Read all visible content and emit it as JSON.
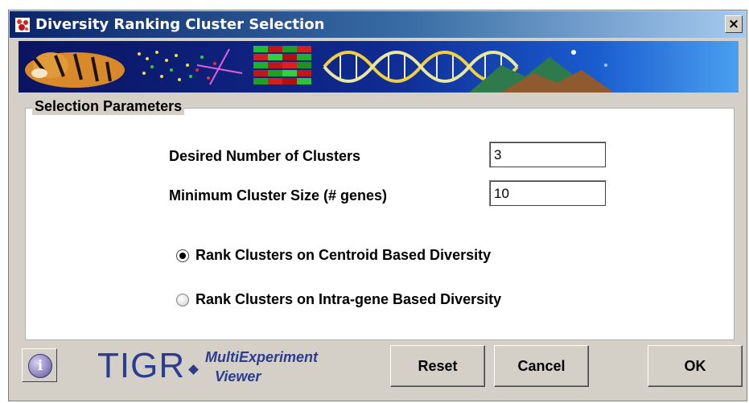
{
  "window": {
    "title": "Diversity Ranking Cluster Selection",
    "close_glyph": "×"
  },
  "params": {
    "legend": "Selection Parameters",
    "clusters_label": "Desired Number of Clusters",
    "clusters_value": "3",
    "min_size_label": "Minimum Cluster Size (# genes)",
    "min_size_value": "10",
    "radios": [
      {
        "label": "Rank Clusters on Centroid Based Diversity",
        "checked": true
      },
      {
        "label": "Rank Clusters on Intra-gene Based Diversity",
        "checked": false
      }
    ]
  },
  "footer": {
    "info_glyph": "i",
    "logo_tigr": "TIGR",
    "logo_line1": "MultiExperiment",
    "logo_line2": "Viewer",
    "reset_label": "Reset",
    "cancel_label": "Cancel",
    "ok_label": "OK"
  },
  "colors": {
    "titlebar_start": "#0a246a",
    "titlebar_end": "#a6caf0",
    "logo_blue": "#2b3d8f",
    "dialog_gray": "#d4d0c8"
  },
  "icons": [
    "app-icon",
    "close-icon",
    "info-icon",
    "banner-image"
  ]
}
